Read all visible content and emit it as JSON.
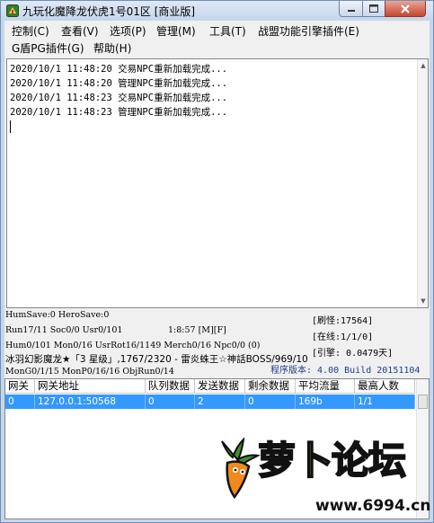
{
  "window": {
    "title": "九玩化魔降龙伏虎1号01区 [商业版]"
  },
  "menu": [
    {
      "label": "控制(C)"
    },
    {
      "label": "查看(V)"
    },
    {
      "label": "选项(P)"
    },
    {
      "label": "管理(M)"
    },
    {
      "label": "工具(T)"
    },
    {
      "label": "战盟功能引擎插件(E)"
    },
    {
      "label": "G盾PG插件(G)"
    },
    {
      "label": "帮助(H)"
    }
  ],
  "log": {
    "lines": [
      "2020/10/1 11:48:20 交易NPC重新加载完成...",
      "2020/10/1 11:48:20 管理NPC重新加载完成...",
      "2020/10/1 11:48:23 交易NPC重新加载完成...",
      "2020/10/1 11:48:23 管理NPC重新加载完成..."
    ]
  },
  "status": {
    "line1": "HumSave:0 HeroSave:0",
    "line2_left": "Run17/11 Soc0/0 Usr0/101",
    "line2_time": "1:8:57 [M][F]",
    "line3": "Hum0/101 Mon0/16 UsrRot16/1149 Merch0/16 Npc0/0 (0)",
    "line4": "冰羽幻影魔龙★「3 星级」,1767/2320 - 雷炎蛛王☆神話BOSS/969/10",
    "line5": "MonG0/1/15 MonP0/16/16 ObjRun0/14",
    "refresh": "[刷怪:17564]",
    "online": "[在线:1/1/0]",
    "engine": "[引擎: 0.0479天]",
    "version": "程序版本: 4.00 Build 20151104"
  },
  "grid": {
    "columns": [
      "网关",
      "网关地址",
      "队列数据",
      "发送数据",
      "剩余数据",
      "平均流量",
      "最高人数"
    ],
    "rows": [
      [
        "0",
        "127.0.0.1:50568",
        "0",
        "2",
        "0",
        "169b",
        "1/1"
      ]
    ]
  },
  "watermark": {
    "text": "萝卜论坛",
    "url": "www.6994.cn"
  },
  "colors": {
    "selection": "#3399ff",
    "version_text": "#1f3c8c",
    "watermark_fill": "#fbcf3a"
  }
}
